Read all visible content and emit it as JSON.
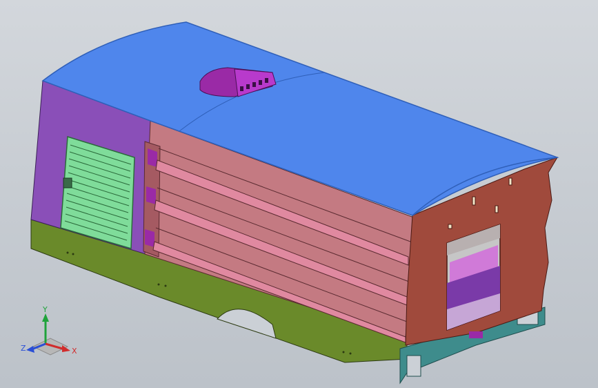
{
  "viewport": {
    "background_top": "#d3d7dc",
    "background_bottom": "#bcc2c9"
  },
  "model": {
    "colors": {
      "roof": "#4f86ec",
      "roof_edge": "#2f5fb8",
      "end_panel": "#8a4fb8",
      "vent_grille": "#7fdc9a",
      "side_panels": "#c47a82",
      "side_rails": "#e089a0",
      "front_wall": "#a04a3c",
      "floor": "#6a8a2a",
      "base_rail": "#3e8c8c",
      "roof_vent": "#9a2aa6",
      "interior_wall": "#7a3aa8",
      "interior_floor": "#d07ad8"
    },
    "icons": [
      "roof-vent-icon",
      "door-opening",
      "vent-grille"
    ]
  },
  "triad": {
    "labels": {
      "y": "Y",
      "x": "X",
      "z": "Z"
    },
    "colors": {
      "y": "#1fa33b",
      "x": "#d12c2c",
      "z": "#2a4fd6"
    }
  }
}
